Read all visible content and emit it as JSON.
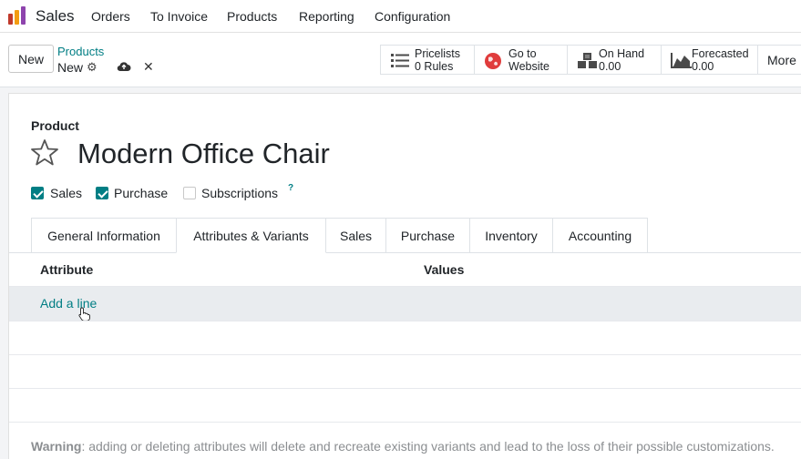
{
  "navbar": {
    "app_name": "Sales",
    "menu": [
      "Orders",
      "To Invoice",
      "Products",
      "Reporting",
      "Configuration"
    ]
  },
  "control_panel": {
    "new_label": "New",
    "breadcrumb_parent": "Products",
    "breadcrumb_current": "New",
    "stat_buttons": [
      {
        "line1": "Pricelists",
        "line2": "0 Rules",
        "icon": "list-icon"
      },
      {
        "line1": "Go to",
        "line2": "Website",
        "icon": "globe-icon"
      },
      {
        "line1": "On Hand",
        "line2": "0.00",
        "icon": "cubes-icon"
      },
      {
        "line1": "Forecasted",
        "line2": "0.00",
        "icon": "area-chart-icon"
      }
    ],
    "more_label": "More"
  },
  "form": {
    "product_label": "Product",
    "product_name": "Modern Office Chair",
    "checkboxes": [
      {
        "label": "Sales",
        "checked": true
      },
      {
        "label": "Purchase",
        "checked": true
      },
      {
        "label": "Subscriptions",
        "checked": false
      }
    ],
    "help_mark": "?"
  },
  "tabs": [
    "General Information",
    "Attributes & Variants",
    "Sales",
    "Purchase",
    "Inventory",
    "Accounting"
  ],
  "active_tab": "Attributes & Variants",
  "table": {
    "columns": [
      "Attribute",
      "Values"
    ],
    "add_line_label": "Add a line"
  },
  "warning": {
    "bold": "Warning",
    "text": ": adding or deleting attributes will delete and recreate existing variants and lead to the loss of their possible customizations."
  },
  "colors": {
    "accent": "#017e84",
    "brand_purple": "#714b67"
  }
}
